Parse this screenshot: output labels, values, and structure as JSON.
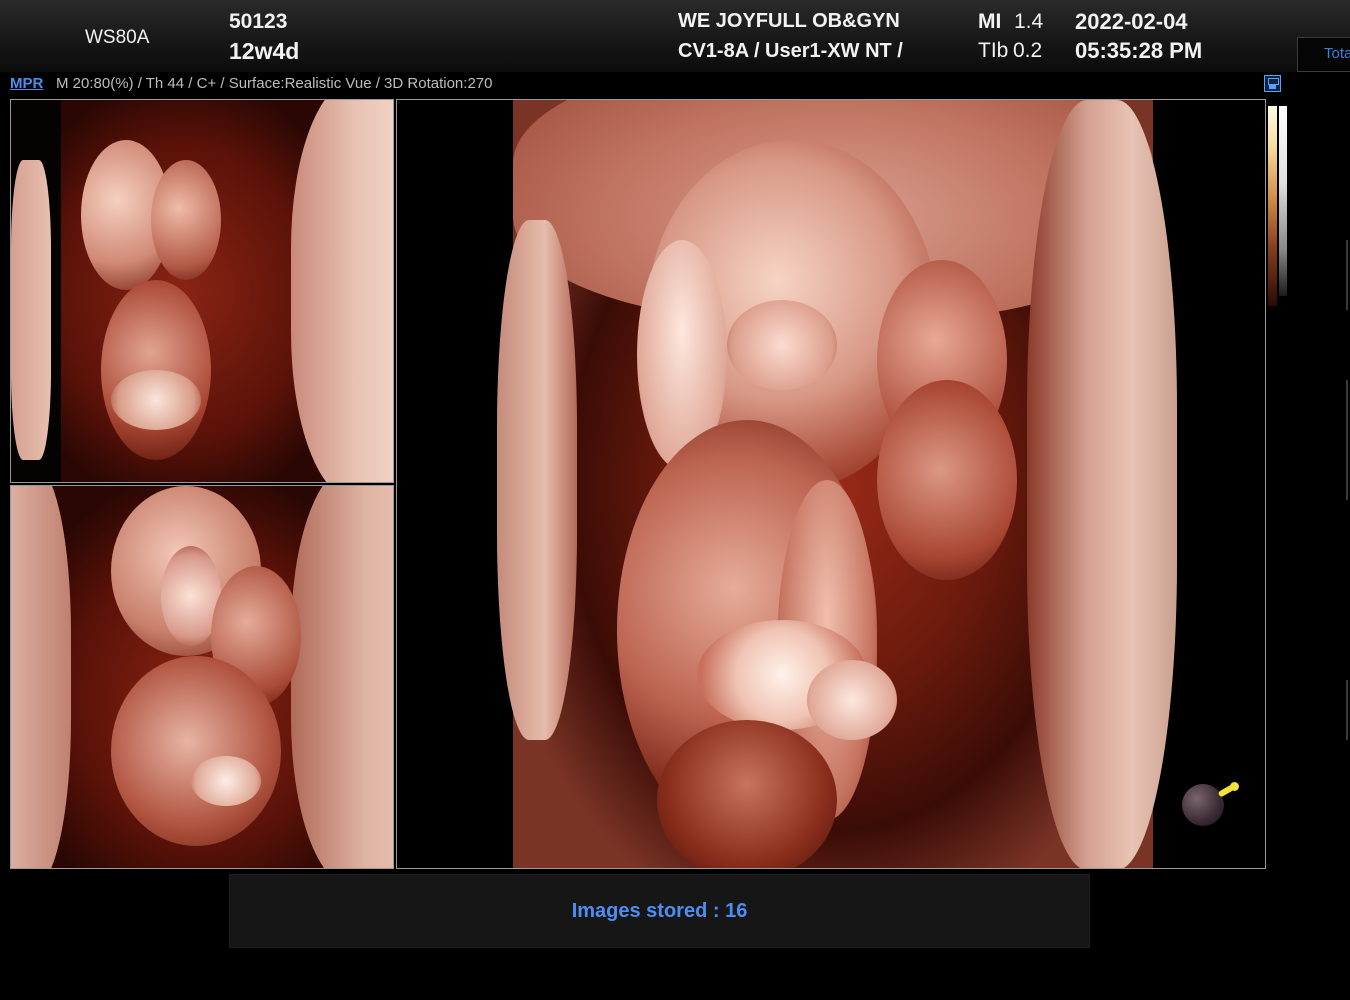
{
  "header": {
    "device": "WS80A",
    "patient_id": "50123",
    "gestational_age": "12w4d",
    "institution": "WE JOYFULL OB&GYN",
    "probe_preset": "CV1-8A / User1-XW NT /",
    "mi_label": "MI",
    "mi_value": "1.4",
    "tib_label": "TIb",
    "tib_value": "0.2",
    "date": "2022-02-04",
    "time": "05:35:28 PM",
    "right_tab": "Total"
  },
  "info_bar": {
    "mode": "MPR",
    "params": "M 20:80(%) / Th 44 / C+ / Surface:Realistic Vue / 3D Rotation:270"
  },
  "status": {
    "message": "Images stored : 16"
  },
  "icons": [
    "save-icon",
    "orientation-marker-icon"
  ],
  "colors": {
    "accent": "#4d8ef2",
    "render_tint": "#a8321e"
  }
}
